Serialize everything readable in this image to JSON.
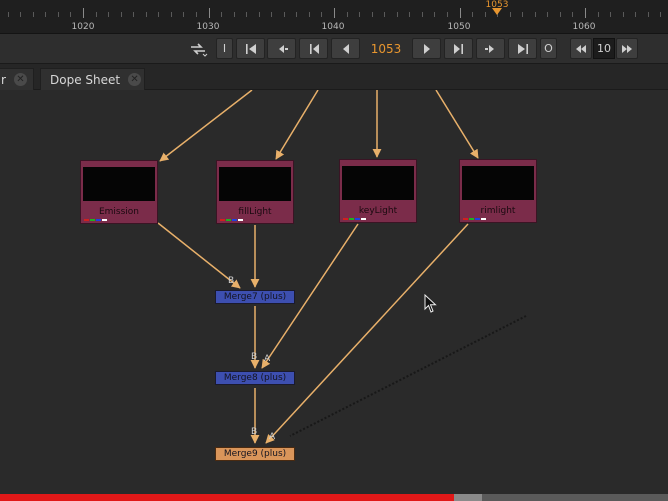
{
  "ruler": {
    "labels": [
      "1020",
      "1030",
      "1040",
      "1050",
      "1060"
    ],
    "current_frame_label": "1053"
  },
  "toolbar": {
    "loop_icon": "loop-icon",
    "in_label": "I",
    "frame": "1053",
    "out_label": "O",
    "increment": "10"
  },
  "tabs": [
    {
      "label": "r"
    },
    {
      "label": "Dope Sheet"
    }
  ],
  "nodes": {
    "read": [
      {
        "label": "Emission"
      },
      {
        "label": "fillLight"
      },
      {
        "label": "keyLight"
      },
      {
        "label": "rimlight"
      }
    ],
    "merge": [
      {
        "label": "Merge7 (plus)"
      },
      {
        "label": "Merge8 (plus)"
      },
      {
        "label": "Merge9 (plus)"
      }
    ],
    "input_labels": {
      "b": "B",
      "a": "A"
    }
  },
  "colors": {
    "accent": "#e8962f",
    "read_node": "#7b2c4a",
    "merge_node": "#3d4fb0",
    "merge_selected": "#d9955a",
    "edge": "#e8b06a",
    "progress": "#e01818"
  },
  "render_progress": 0.68
}
